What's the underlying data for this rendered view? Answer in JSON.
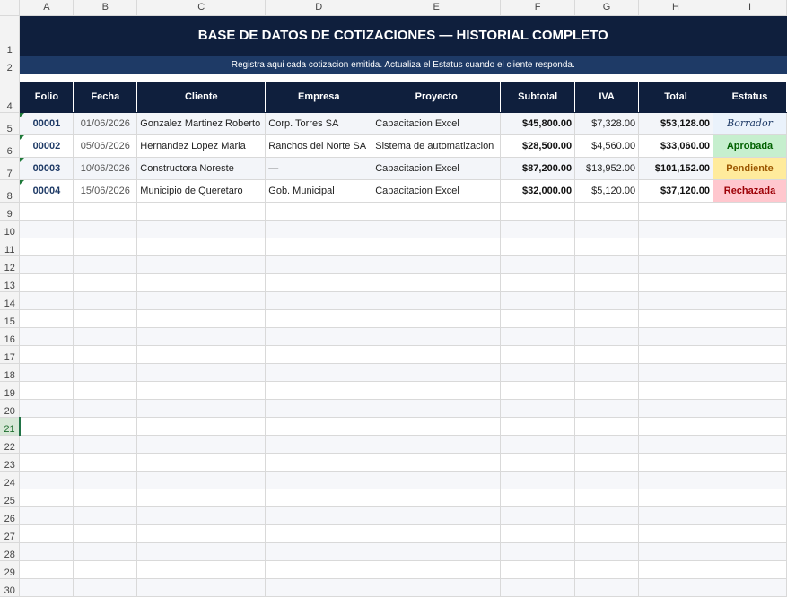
{
  "columns": [
    "A",
    "B",
    "C",
    "D",
    "E",
    "F",
    "G",
    "H",
    "I"
  ],
  "title": "BASE DE DATOS DE COTIZACIONES — HISTORIAL COMPLETO",
  "subtitle": "Registra aqui cada cotizacion emitida. Actualiza el Estatus cuando el cliente responda.",
  "row_numbers": [
    "1",
    "2",
    "3",
    "4",
    "5",
    "6",
    "7",
    "8",
    "9",
    "10",
    "11",
    "12",
    "13",
    "14",
    "15",
    "16",
    "17",
    "18",
    "19",
    "20",
    "21",
    "22",
    "23",
    "24",
    "25",
    "26",
    "27",
    "28",
    "29",
    "30"
  ],
  "headers": [
    "Folio",
    "Fecha",
    "Cliente",
    "Empresa",
    "Proyecto",
    "Subtotal",
    "IVA",
    "Total",
    "Estatus"
  ],
  "records": [
    {
      "folio": "00001",
      "fecha": "01/06/2026",
      "cliente": "Gonzalez Martinez Roberto",
      "empresa": "Corp. Torres SA",
      "proyecto": "Capacitacion Excel",
      "subtotal": "$45,800.00",
      "iva": "$7,328.00",
      "total": "$53,128.00",
      "estatus": "Borrador",
      "estatus_color": "#eaf2fb"
    },
    {
      "folio": "00002",
      "fecha": "05/06/2026",
      "cliente": "Hernandez Lopez Maria",
      "empresa": "Ranchos del Norte SA",
      "proyecto": "Sistema de automatizacion",
      "subtotal": "$28,500.00",
      "iva": "$4,560.00",
      "total": "$33,060.00",
      "estatus": "Aprobada",
      "estatus_color": "#c6efce"
    },
    {
      "folio": "00003",
      "fecha": "10/06/2026",
      "cliente": "Constructora Noreste",
      "empresa": "—",
      "proyecto": "Capacitacion Excel",
      "subtotal": "$87,200.00",
      "iva": "$13,952.00",
      "total": "$101,152.00",
      "estatus": "Pendiente",
      "estatus_color": "#ffeb9c"
    },
    {
      "folio": "00004",
      "fecha": "15/06/2026",
      "cliente": "Municipio de Queretaro",
      "empresa": "Gob. Municipal",
      "proyecto": "Capacitacion Excel",
      "subtotal": "$32,000.00",
      "iva": "$5,120.00",
      "total": "$37,120.00",
      "estatus": "Rechazada",
      "estatus_color": "#ffc7ce"
    }
  ],
  "selected_row": "21"
}
